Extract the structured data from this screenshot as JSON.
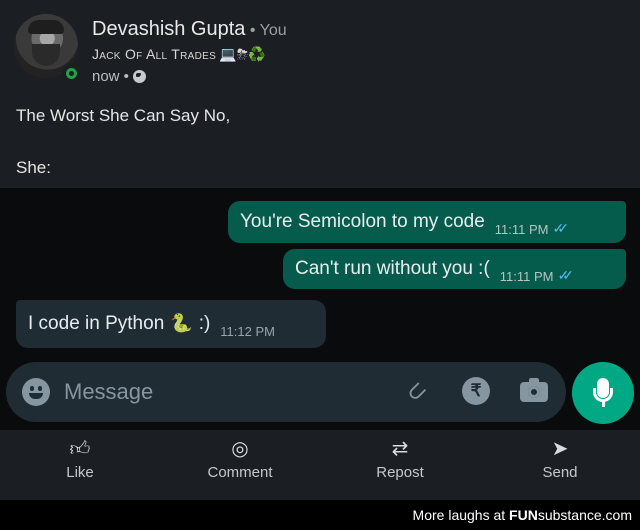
{
  "post": {
    "author_name": "Devashish Gupta",
    "author_suffix": "• You",
    "tagline": "Jack Of All Trades",
    "tagline_emojis": "💻⛈♻️",
    "posted": "now •",
    "line1": "The Worst She Can Say No,",
    "line2": "She:"
  },
  "chat": {
    "messages": [
      {
        "direction": "outgoing",
        "text": "You're Semicolon to my code",
        "time": "11:11 PM",
        "ticks": "✓✓"
      },
      {
        "direction": "outgoing",
        "text": "Can't run without you :(",
        "time": "11:11 PM",
        "ticks": "✓✓"
      },
      {
        "direction": "incoming",
        "text_before": "I code in Python",
        "emoji": "🐍",
        "text_after": ":)",
        "time": "11:12 PM"
      }
    ],
    "input_placeholder": "Message",
    "icons": [
      "emoji-icon",
      "attachment-icon",
      "rupee-payment-icon",
      "camera-icon",
      "mic-icon"
    ],
    "colors": {
      "outgoing_bubble": "#065c4c",
      "incoming_bubble": "#1f2c33",
      "read_ticks": "#53bdeb",
      "mic_button": "#00a884"
    }
  },
  "actions": {
    "like": "Like",
    "comment": "Comment",
    "repost": "Repost",
    "send": "Send"
  },
  "watermark": {
    "prefix": "More laughs at",
    "brand_fun": "FUN",
    "brand_rest": "substance.com"
  }
}
